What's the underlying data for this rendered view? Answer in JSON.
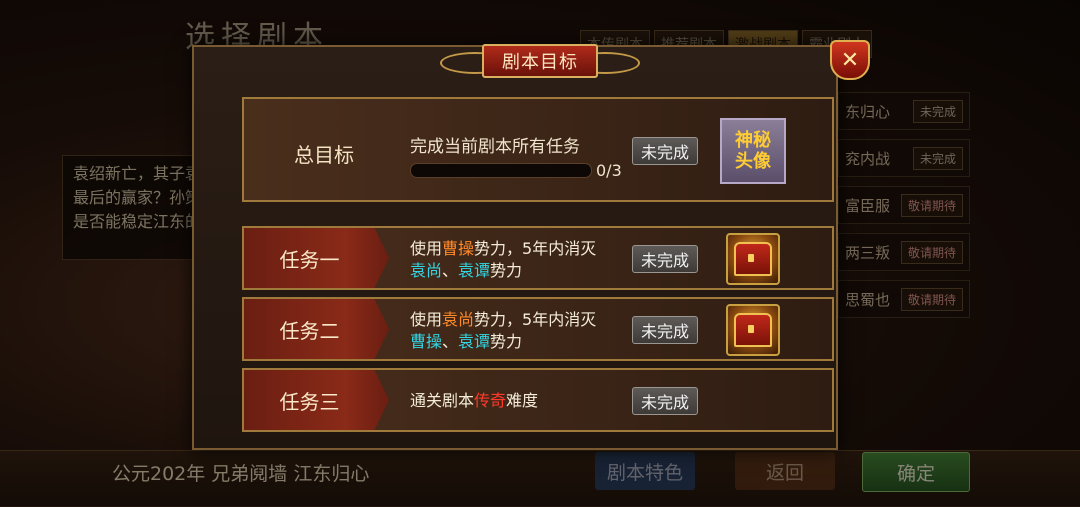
{
  "background": {
    "scene_title": "选择剧本",
    "tabs": [
      "本传剧本",
      "推荐剧本",
      "激战剧本",
      "霸业剧本"
    ],
    "description_lines": [
      "袁绍新亡，其子袁",
      "最后的赢家？孙策",
      "是否能稳定江东的"
    ],
    "scenario_list": [
      {
        "name": "东归心",
        "status": "未完成"
      },
      {
        "name": "兖内战",
        "status": "未完成"
      },
      {
        "name": "富臣服",
        "status": "敬请期待"
      },
      {
        "name": "两三叛",
        "status": "敬请期待"
      },
      {
        "name": "思蜀也",
        "status": "敬请期待"
      }
    ],
    "bottom_bar_text": "公元202年  兄弟阋墙 江东归心",
    "bottom_buttons": {
      "left": "剧本特色",
      "middle": "返回",
      "confirm": "确定"
    }
  },
  "modal": {
    "title": "剧本目标",
    "close_icon": "close-x-icon",
    "total_goal": {
      "label": "总目标",
      "description": "完成当前剧本所有任务",
      "progress_current": 0,
      "progress_total": 3,
      "progress_text": "0/3",
      "status": "未完成",
      "reward_line1": "神秘",
      "reward_line2": "头像"
    },
    "tasks": [
      {
        "label": "任务一",
        "line1_prefix": "使用",
        "line1_highlight": "曹操",
        "line1_suffix": "势力，5年内消灭",
        "line2_a": "袁尚",
        "line2_sep": "、",
        "line2_b": "袁谭",
        "line2_suffix": "势力",
        "status": "未完成",
        "reward_icon": "treasure-chest-icon"
      },
      {
        "label": "任务二",
        "line1_prefix": "使用",
        "line1_highlight": "袁尚",
        "line1_suffix": "势力，5年内消灭",
        "line2_a": "曹操",
        "line2_sep": "、",
        "line2_b": "袁谭",
        "line2_suffix": "势力",
        "status": "未完成",
        "reward_icon": "treasure-chest-icon"
      },
      {
        "label": "任务三",
        "prefix": "通关剧本",
        "highlight": "传奇",
        "suffix": "难度",
        "status": "未完成"
      }
    ]
  },
  "colors": {
    "highlight_orange": "#ff8a2a",
    "highlight_cyan": "#32d6e6",
    "highlight_red": "#ff3a2a",
    "confirm_green": "#3a7a2e"
  }
}
